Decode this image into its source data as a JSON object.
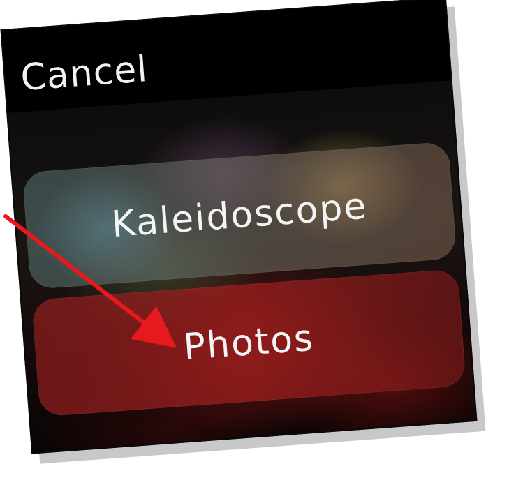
{
  "screen": {
    "cancel_label": "Cancel",
    "options": [
      {
        "label": "Kaleidoscope"
      },
      {
        "label": "Photos"
      }
    ]
  },
  "annotation": {
    "arrow_color": "#e8191e",
    "points_to": "Photos"
  },
  "colors": {
    "screen_background": "#000000",
    "text": "#f4f4f4",
    "photos_button": "#8c1e1e",
    "kaleidoscope_button": "#6e7a78"
  }
}
